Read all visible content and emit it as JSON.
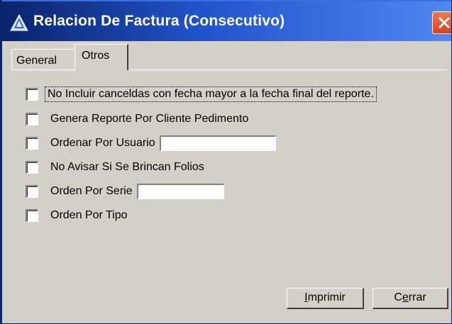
{
  "window": {
    "title": "Relacion De Factura (Consecutivo)",
    "title_icon": "app-triangle-icon",
    "close_icon": "close-icon"
  },
  "tabs": [
    {
      "label": "General",
      "active": false
    },
    {
      "label": "Otros",
      "active": true
    }
  ],
  "options": [
    {
      "label": "No Incluir canceldas con fecha mayor a la fecha final del reporte.",
      "checked": false,
      "focused": true
    },
    {
      "label": "Genera Reporte Por Cliente Pedimento",
      "checked": false
    },
    {
      "label": "Ordenar Por Usuario",
      "checked": false,
      "input_value": ""
    },
    {
      "label": "No Avisar Si Se Brincan Folios",
      "checked": false
    },
    {
      "label": "Orden Por Serie",
      "checked": false,
      "input_value": ""
    },
    {
      "label": "Orden Por Tipo",
      "checked": false
    }
  ],
  "buttons": {
    "print": {
      "pre": "",
      "mnemonic": "I",
      "post": "mprimir"
    },
    "close": {
      "pre": "C",
      "mnemonic": "e",
      "post": "rrar"
    }
  },
  "colors": {
    "titlebar_start": "#0a246a",
    "titlebar_end": "#4f88f0",
    "face": "#d4d0c8",
    "close_button": "#d8421e"
  }
}
